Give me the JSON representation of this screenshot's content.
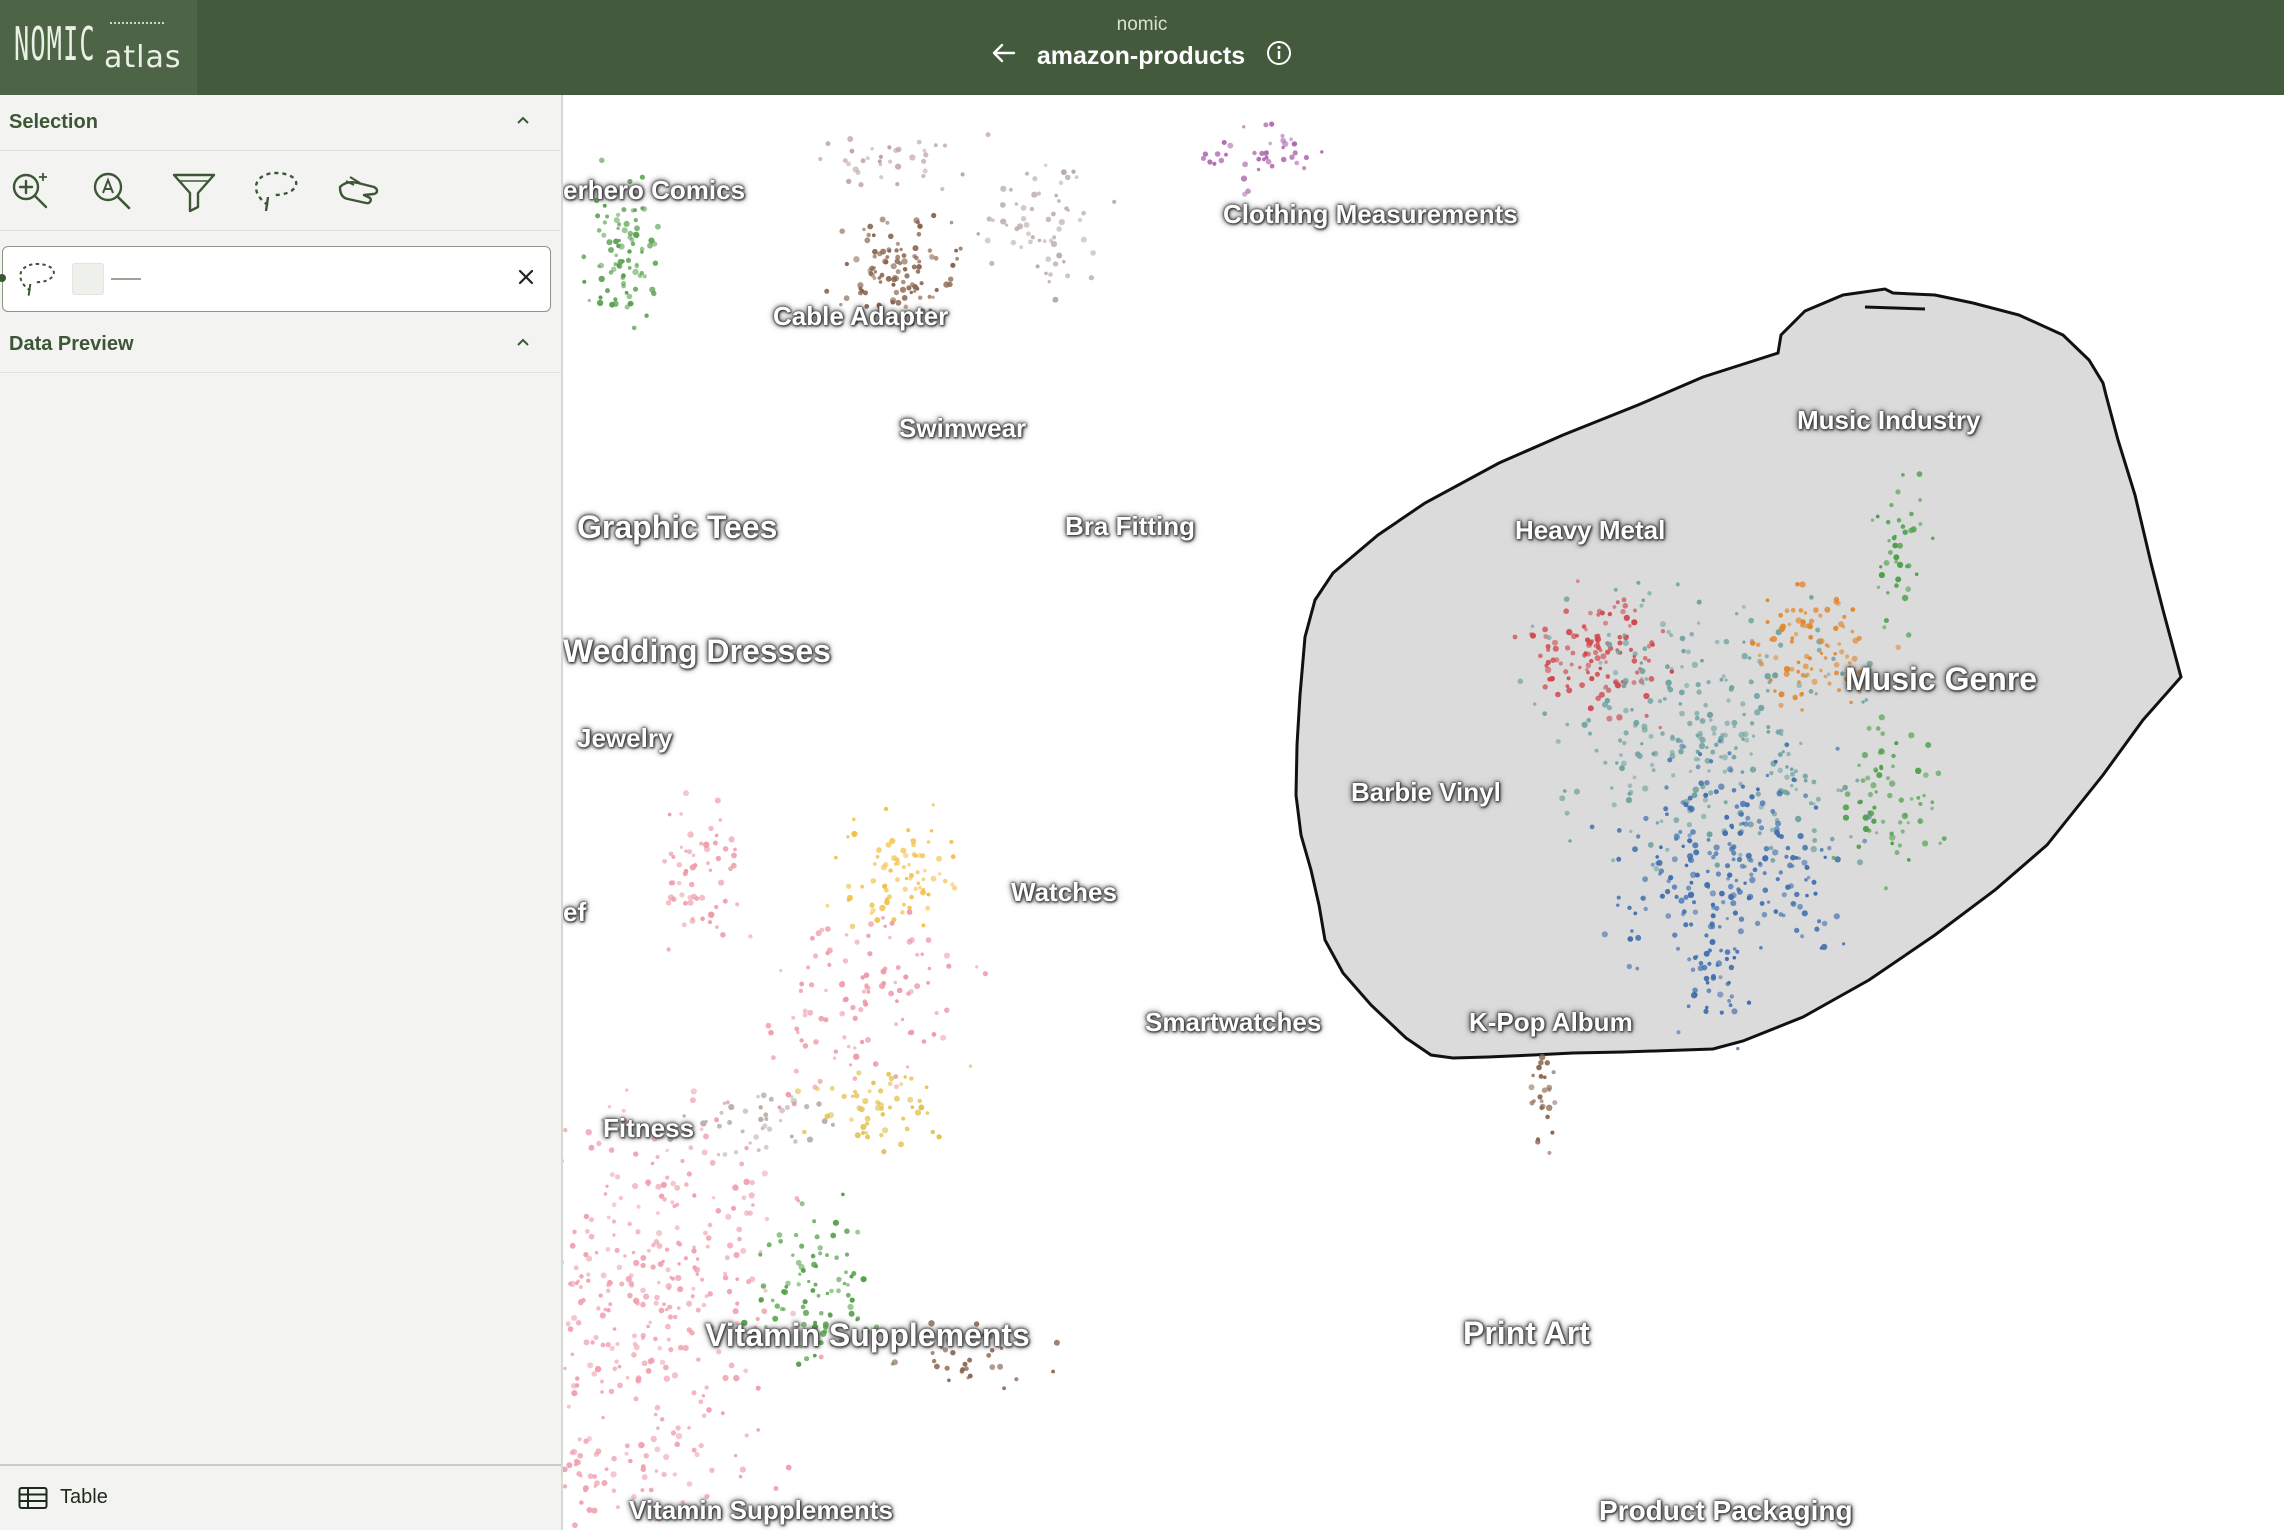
{
  "header": {
    "logo_mark": "NOMIC",
    "logo_text": "atlas",
    "org": "nomic",
    "title": "amazon-products"
  },
  "sidebar": {
    "selection_label": "Selection",
    "tools": [
      "zoom-in-icon",
      "text-search-icon",
      "filter-icon",
      "lasso-icon",
      "pan-hand-icon"
    ],
    "data_preview_label": "Data Preview",
    "table_label": "Table"
  },
  "colors": {
    "header_bg": "#435a3c",
    "logo_bg": "#4d6546",
    "accent": "#3c5636",
    "sidebar_bg": "#f3f4f1",
    "lasso_fill": "#dadada"
  },
  "map": {
    "labels": [
      {
        "text": "erhero Comics",
        "size": 26
      },
      {
        "text": "Clothing Measurements",
        "size": 26
      },
      {
        "text": "Cable Adapter",
        "size": 26
      },
      {
        "text": "Swimwear",
        "size": 26
      },
      {
        "text": "Music Industry",
        "size": 26
      },
      {
        "text": "Graphic Tees",
        "size": 32
      },
      {
        "text": "Bra Fitting",
        "size": 26
      },
      {
        "text": "Heavy Metal",
        "size": 26
      },
      {
        "text": "Wedding Dresses",
        "size": 32
      },
      {
        "text": "Music Genre",
        "size": 32
      },
      {
        "text": "Jewelry",
        "size": 26
      },
      {
        "text": "Barbie Vinyl",
        "size": 26
      },
      {
        "text": "Watches",
        "size": 26
      },
      {
        "text": "ef",
        "size": 26
      },
      {
        "text": "Smartwatches",
        "size": 26
      },
      {
        "text": "K-Pop Album",
        "size": 26
      },
      {
        "text": "Fitness",
        "size": 26
      },
      {
        "text": "Vitamin Supplements",
        "size": 32
      },
      {
        "text": "Print Art",
        "size": 32
      },
      {
        "text": "Vitamin Supplements",
        "size": 26
      },
      {
        "text": "Product Packaging",
        "size": 28
      }
    ]
  }
}
